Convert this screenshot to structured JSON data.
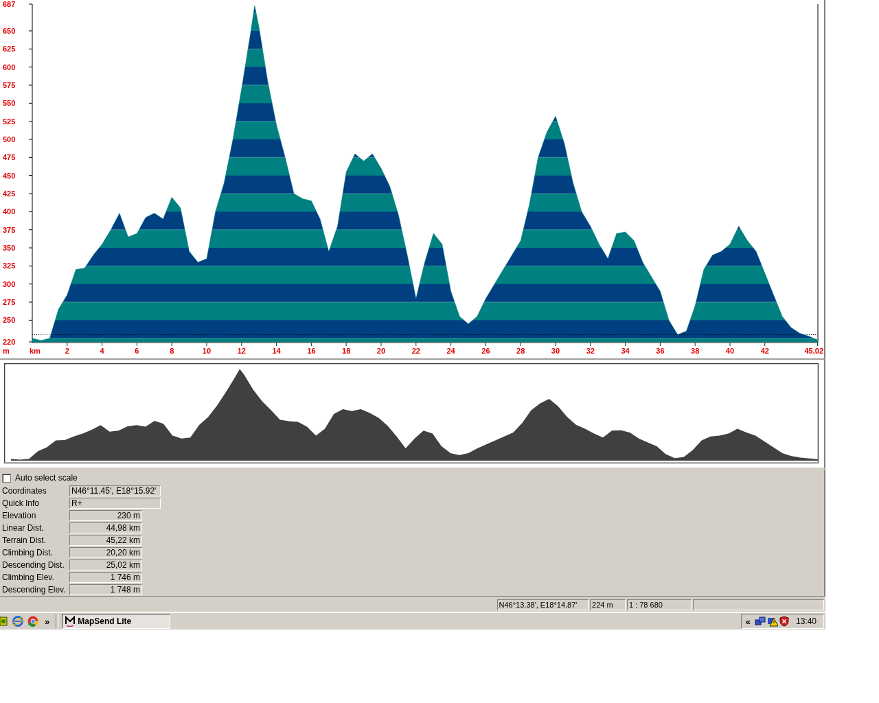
{
  "elevation_profile": {
    "chart_data": {
      "type": "area",
      "xlabel": "km",
      "ylabel": "m",
      "x": [
        0,
        0.5,
        1,
        1.5,
        2,
        2.5,
        3,
        3.5,
        4,
        4.5,
        5,
        5.5,
        6,
        6.5,
        7,
        7.5,
        8,
        8.5,
        9,
        9.5,
        10,
        10.5,
        11,
        11.5,
        12,
        12.5,
        12.75,
        13,
        13.5,
        14,
        14.5,
        15,
        15.5,
        16,
        16.5,
        17,
        17.5,
        18,
        18.5,
        19,
        19.5,
        20,
        20.5,
        21,
        21.5,
        22,
        22.5,
        23,
        23.5,
        24,
        24.5,
        25,
        25.5,
        26,
        26.5,
        27,
        27.5,
        28,
        28.5,
        29,
        29.5,
        30,
        30.5,
        31,
        31.5,
        32,
        32.5,
        33,
        33.5,
        34,
        34.5,
        35,
        35.5,
        36,
        36.5,
        37,
        37.5,
        38,
        38.5,
        39,
        39.5,
        40,
        40.5,
        41,
        41.5,
        42,
        42.5,
        43,
        43.5,
        44,
        44.5,
        45,
        45.02
      ],
      "series": [
        {
          "color": "#008080",
          "values": [
            225,
            222,
            225,
            265,
            285,
            320,
            322,
            340,
            355,
            375,
            398,
            365,
            370,
            392,
            398,
            390,
            420,
            405,
            345,
            330,
            335,
            400,
            440,
            500,
            570,
            645,
            685,
            655,
            580,
            520,
            475,
            425,
            418,
            415,
            390,
            345,
            380,
            455,
            480,
            470,
            480,
            460,
            435,
            395,
            340,
            280,
            330,
            370,
            355,
            290,
            255,
            245,
            255,
            280,
            300,
            320,
            340,
            360,
            410,
            475,
            510,
            532,
            495,
            440,
            400,
            380,
            355,
            335,
            370,
            372,
            360,
            330,
            310,
            290,
            250,
            230,
            235,
            270,
            320,
            340,
            345,
            355,
            380,
            360,
            345,
            315,
            285,
            255,
            240,
            232,
            228,
            223,
            222
          ]
        }
      ],
      "xlim": [
        0,
        45.02
      ],
      "ylim": [
        220,
        687
      ],
      "xticks": [
        2,
        4,
        6,
        8,
        10,
        12,
        14,
        16,
        18,
        20,
        22,
        24,
        26,
        28,
        30,
        32,
        34,
        36,
        38,
        40,
        42,
        {
          "value": 45.02,
          "label": "45,02"
        }
      ],
      "yticks": [
        220,
        250,
        275,
        300,
        325,
        350,
        375,
        400,
        425,
        450,
        475,
        500,
        525,
        550,
        575,
        600,
        625,
        650,
        687
      ],
      "ref_lines": [
        {
          "axis": "y",
          "value": 230
        }
      ]
    }
  },
  "options": {
    "auto_select_scale": {
      "label": "Auto select scale",
      "checked": false
    }
  },
  "info": [
    {
      "label": "Coordinates",
      "value": "N46°11.45', E18°15.92'",
      "kind": "text"
    },
    {
      "label": "Quick Info",
      "value": "R+",
      "kind": "text"
    },
    {
      "label": "Elevation",
      "value": "230 m",
      "kind": "measure"
    },
    {
      "label": "Linear Dist.",
      "value": "44,98 km",
      "kind": "measure"
    },
    {
      "label": "Terrain Dist.",
      "value": "45,22 km",
      "kind": "measure"
    },
    {
      "label": "Climbing Dist.",
      "value": "20,20 km",
      "kind": "measure"
    },
    {
      "label": "Descending Dist.",
      "value": "25,02 km",
      "kind": "measure"
    },
    {
      "label": "Climbing Elev.",
      "value": "1 746 m",
      "kind": "measure"
    },
    {
      "label": "Descending Elev.",
      "value": "1 748 m",
      "kind": "measure"
    }
  ],
  "status_bar": [
    "N46°13.38', E18°14.87'",
    "224 m",
    "1 : 78 680"
  ],
  "taskbar": {
    "quick_launch_more": "»",
    "tasks": [
      {
        "label": "MapSend Lite",
        "selected": true
      }
    ],
    "tray_expand": "«",
    "clock": "13:40"
  }
}
